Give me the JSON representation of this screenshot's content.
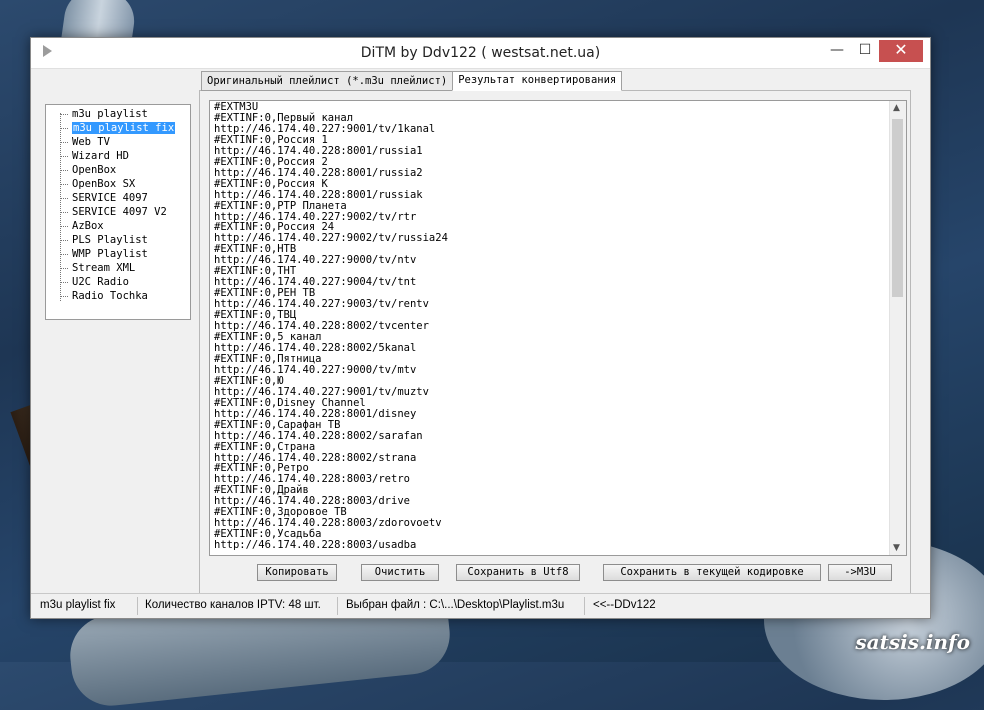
{
  "window": {
    "title": "DiTM by Ddv122 ( westsat.net.ua)",
    "minimize": "—",
    "maximize": "☐",
    "close": "✕"
  },
  "tabs": [
    {
      "label": "Оригинальный плейлист (*.m3u плейлист)"
    },
    {
      "label": "Результат конвертирования"
    }
  ],
  "formats": [
    {
      "label": "m3u playlist"
    },
    {
      "label": "m3u playlist fix"
    },
    {
      "label": "Web TV"
    },
    {
      "label": "Wizard HD"
    },
    {
      "label": "OpenBox"
    },
    {
      "label": "OpenBox SX"
    },
    {
      "label": "SERVICE 4097"
    },
    {
      "label": "SERVICE 4097 V2"
    },
    {
      "label": "AzBox"
    },
    {
      "label": "PLS Playlist"
    },
    {
      "label": "WMP Playlist"
    },
    {
      "label": "Stream XML"
    },
    {
      "label": "U2C Radio"
    },
    {
      "label": "Radio Tochka"
    }
  ],
  "editor_lines": [
    "#EXTM3U",
    "#EXTINF:0,Первый канал",
    "http://46.174.40.227:9001/tv/1kanal",
    "#EXTINF:0,Россия 1",
    "http://46.174.40.228:8001/russia1",
    "#EXTINF:0,Россия 2",
    "http://46.174.40.228:8001/russia2",
    "#EXTINF:0,Россия К",
    "http://46.174.40.228:8001/russiak",
    "#EXTINF:0,РТР Планета",
    "http://46.174.40.227:9002/tv/rtr",
    "#EXTINF:0,Россия 24",
    "http://46.174.40.227:9002/tv/russia24",
    "#EXTINF:0,НТВ",
    "http://46.174.40.227:9000/tv/ntv",
    "#EXTINF:0,ТНТ",
    "http://46.174.40.227:9004/tv/tnt",
    "#EXTINF:0,РЕН ТВ",
    "http://46.174.40.227:9003/tv/rentv",
    "#EXTINF:0,ТВЦ",
    "http://46.174.40.228:8002/tvcenter",
    "#EXTINF:0,5 канал",
    "http://46.174.40.228:8002/5kanal",
    "#EXTINF:0,Пятница",
    "http://46.174.40.227:9000/tv/mtv",
    "#EXTINF:0,Ю",
    "http://46.174.40.227:9001/tv/muztv",
    "#EXTINF:0,Disney Channel",
    "http://46.174.40.228:8001/disney",
    "#EXTINF:0,Сарафан ТВ",
    "http://46.174.40.228:8002/sarafan",
    "#EXTINF:0,Страна",
    "http://46.174.40.228:8002/strana",
    "#EXTINF:0,Ретро",
    "http://46.174.40.228:8003/retro",
    "#EXTINF:0,Драйв",
    "http://46.174.40.228:8003/drive",
    "#EXTINF:0,Здоровое ТВ",
    "http://46.174.40.228:8003/zdorovoetv",
    "#EXTINF:0,Усадьба",
    "http://46.174.40.228:8003/usadba"
  ],
  "buttons": {
    "copy": "Копировать",
    "clear": "Очистить",
    "save_utf8": "Сохранить в Utf8",
    "save_current": "Сохранить в текущей кодировке",
    "to_m3u": "->M3U"
  },
  "status": {
    "format": "m3u playlist fix",
    "channels": "Количество каналов IPTV: 48 шт.",
    "file": "Выбран файл  : C:\\...\\Desktop\\Playlist.m3u",
    "author": "<<--DDv122"
  },
  "watermark": "satsis.info",
  "icons": {
    "app": "app-icon",
    "scroll_up": "scroll-up-arrow-icon",
    "scroll_down": "scroll-down-arrow-icon"
  }
}
